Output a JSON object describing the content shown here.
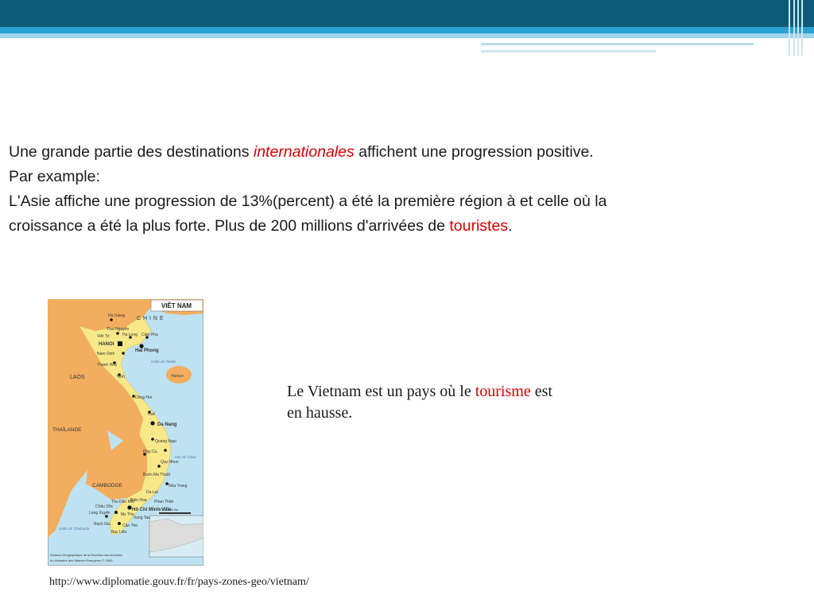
{
  "paragraph": {
    "line1_a": "Une grande partie des destinations ",
    "line1_italic": "internationales",
    "line1_b": " affichent une progression positive.",
    "line2": "Par example:",
    "line3": "L'Asie affiche une progression de 13%(percent) a été la première région à et celle où la",
    "line4_a": "croissance a été la plus forte. Plus de 200 millions d'arrivées de ",
    "line4_red": "touristes",
    "line4_b": "."
  },
  "map": {
    "title": "VIÊT NAM",
    "labels": {
      "chine": "C H I N E",
      "laos": "LAOS",
      "thailande": "THAÏLANDE",
      "cambodge": "CAMBODGE",
      "hanoi": "HANOI",
      "haiphong": "Hai Phong",
      "danang": "Da Nang",
      "hochiminh": "Hô Chi Minh-Ville",
      "hainan": "Hainan",
      "golfe_tonkin": "Golfe du Tonkin",
      "mer": "Mer de Chine",
      "hagiang": "Ha Giang",
      "thainguyen": "Thai Nguyên",
      "viettri": "Viêt Tri",
      "halong": "Ha Long",
      "campha": "Câm Pha",
      "namdinh": "Nam Dinh",
      "thanhhoa": "Thanh Hoa",
      "vinh": "Vinh",
      "donghoi": "Dông Hoi",
      "hue": "Huê",
      "quangngai": "Quang Ngai",
      "playcu": "Play Cu",
      "quynhon": "Quy Nhon",
      "buonmathuot": "Buôn Ma Thuôt",
      "nhatrang": "Nha Trang",
      "dalat": "Da Lat",
      "phanthiet": "Phan Thiêt",
      "bienhoa": "Biên Hoa",
      "thudaumot": "Thu Dâu Môt",
      "chaudoc": "Châu Dôc",
      "longxuyen": "Long Xuyên",
      "mytho": "My Tho",
      "cantho": "Cân Tho",
      "vungtau": "Vung Tau",
      "rachgia": "Rach Gia",
      "baclieu": "Bac Liêu",
      "golfe_thailande": "Golfe de Thaïlande",
      "scale": "0   100   200 km",
      "credit1": "Division Géographique de la Direction des Archives",
      "credit2": "du Ministère des Affaires Etrangères   © 2005"
    }
  },
  "caption": {
    "a": "Le Vietnam est un pays où  le ",
    "red": "tourisme",
    "b": " est",
    "line2": "en hausse."
  },
  "source_url": "http://www.diplomatie.gouv.fr/fr/pays-zones-geo/vietnam/",
  "colors": {
    "header_dark": "#0c5b78",
    "header_light": "#2aa0d4",
    "accent_red": "#d40000",
    "sea": "#bfe2f2",
    "vietnam_land": "#f7e98a",
    "neighbor_land": "#f2ad5e"
  }
}
